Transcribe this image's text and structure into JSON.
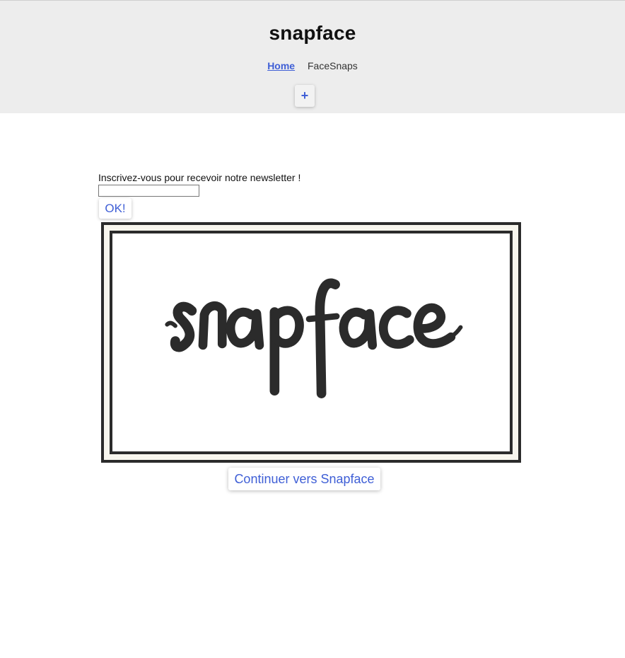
{
  "header": {
    "title": "snapface",
    "nav": [
      {
        "label": "Home",
        "active": true
      },
      {
        "label": "FaceSnaps",
        "active": false
      }
    ],
    "add_button_label": "+"
  },
  "newsletter": {
    "label": "Inscrivez-vous pour recevoir notre newsletter !",
    "input_value": "",
    "submit_label": "OK!"
  },
  "logo": {
    "text": "snapface"
  },
  "continue_button_label": "Continuer vers Snapface",
  "colors": {
    "accent": "#3f5fd6",
    "header_bg": "#ededed",
    "logo_ink": "#2b2b2b"
  }
}
